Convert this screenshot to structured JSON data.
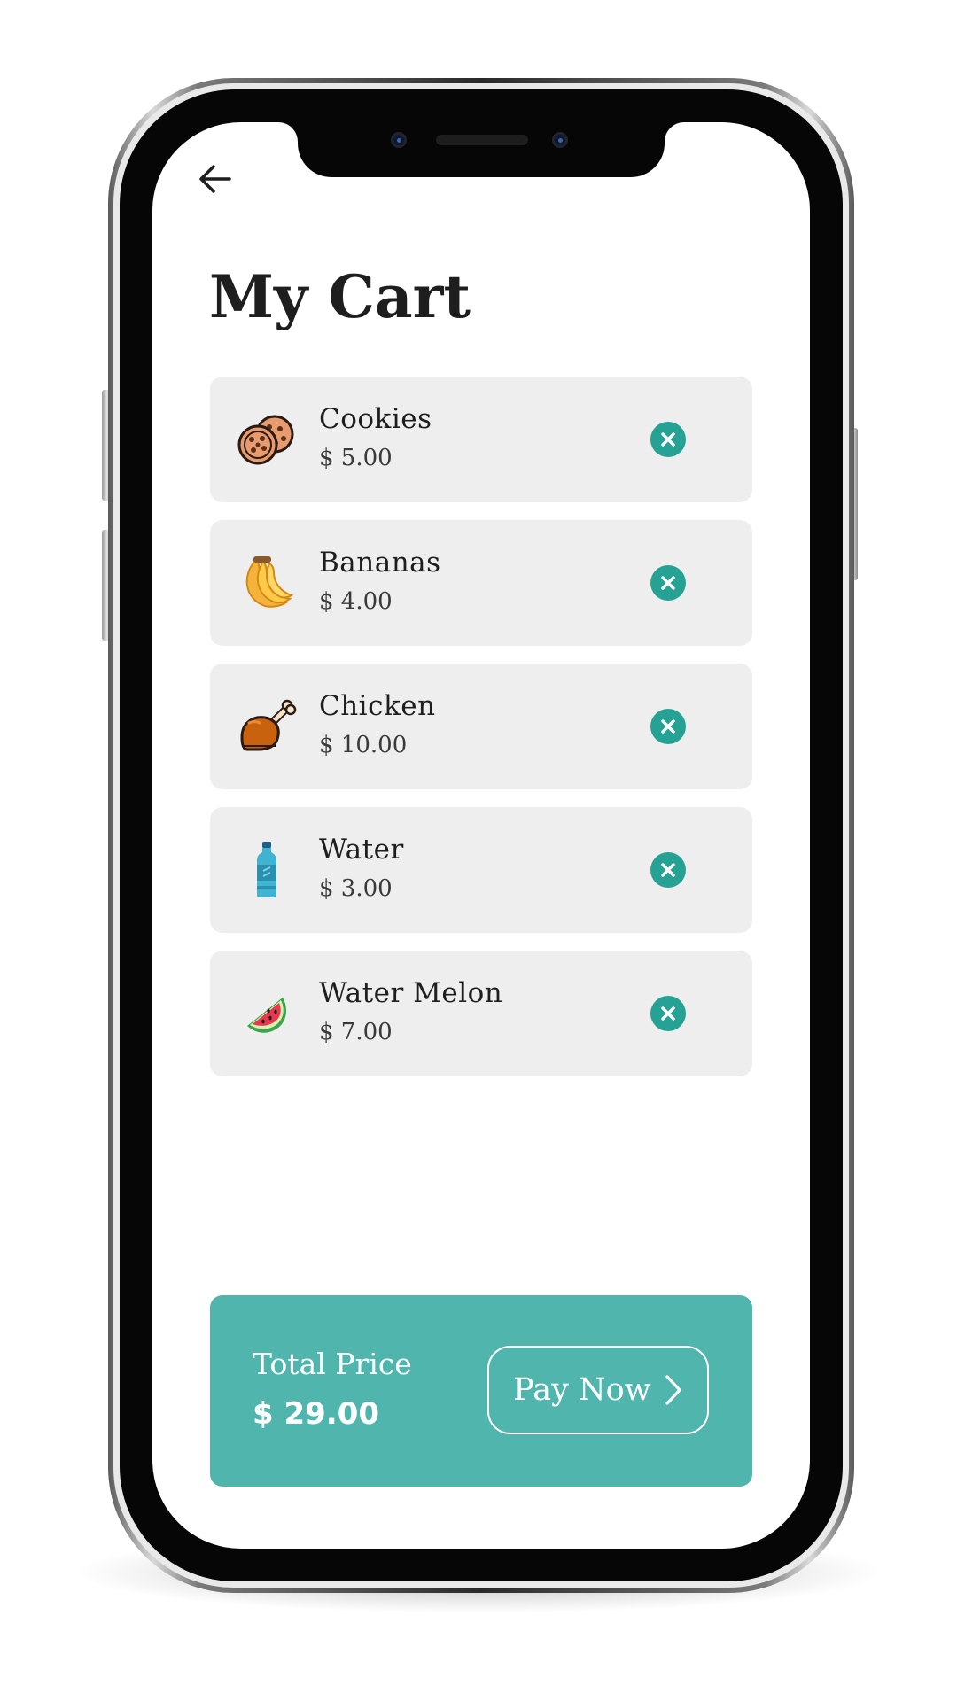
{
  "colors": {
    "accent": "#50b6ad",
    "remove_button": "#26a295",
    "card_background": "#eeeeee",
    "title_text": "#1e1e1e"
  },
  "header": {
    "back_icon": "arrow-left-icon",
    "title": "My Cart"
  },
  "cart": {
    "items": [
      {
        "name": "Cookies",
        "price": "$ 5.00",
        "icon": "cookies-icon"
      },
      {
        "name": "Bananas",
        "price": "$ 4.00",
        "icon": "bananas-icon"
      },
      {
        "name": "Chicken",
        "price": "$ 10.00",
        "icon": "chicken-icon"
      },
      {
        "name": "Water",
        "price": "$ 3.00",
        "icon": "water-bottle-icon"
      },
      {
        "name": "Water Melon",
        "price": "$ 7.00",
        "icon": "watermelon-icon"
      }
    ],
    "remove_icon": "close-circle-icon"
  },
  "footer": {
    "total_label": "Total Price",
    "total_value": "$ 29.00",
    "pay_label": "Pay Now",
    "pay_icon": "chevron-right-icon"
  }
}
